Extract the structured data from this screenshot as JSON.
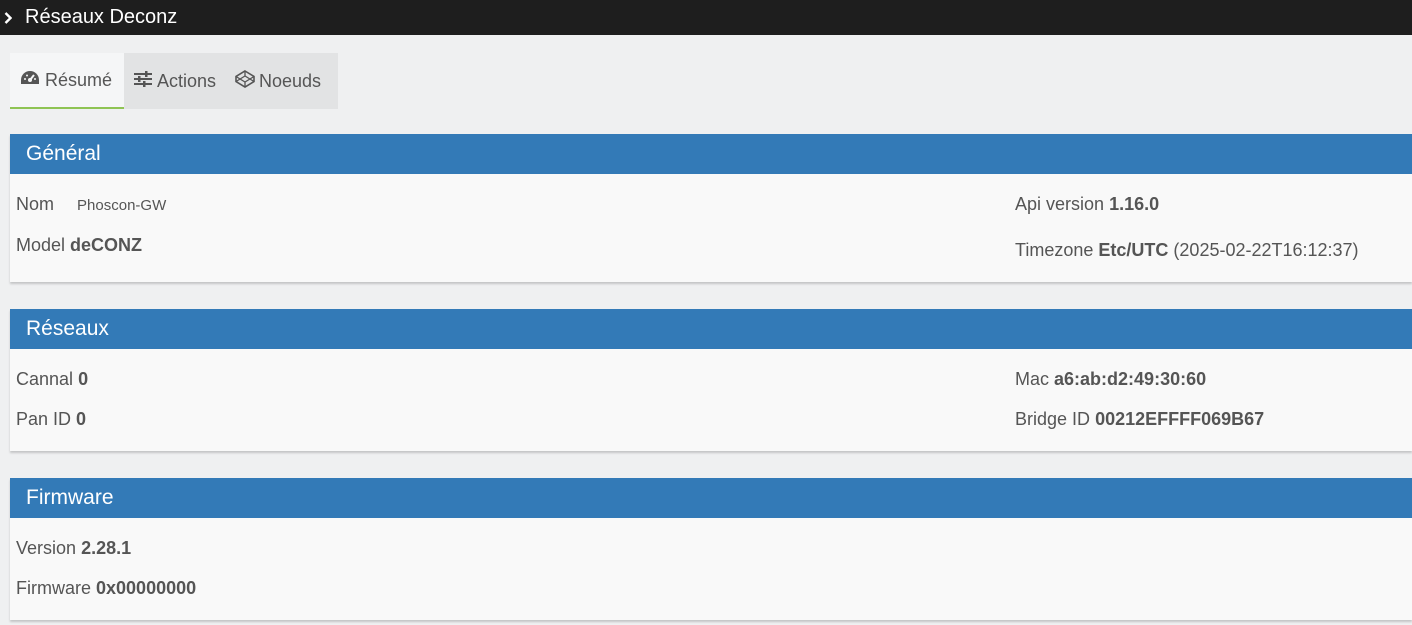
{
  "header": {
    "title": "Réseaux Deconz",
    "icon": "chevron-right-icon"
  },
  "tabs": [
    {
      "label": "Résumé",
      "icon": "dashboard-gauge-icon",
      "active": true
    },
    {
      "label": "Actions",
      "icon": "sliders-icon",
      "active": false
    },
    {
      "label": "Noeuds",
      "icon": "codepen-cube-icon",
      "active": false
    }
  ],
  "general": {
    "title": "Général",
    "name_label": "Nom",
    "name_value": "Phoscon-GW",
    "model_label": "Model",
    "model_value": "deCONZ",
    "api_label": "Api version",
    "api_value": "1.16.0",
    "tz_label": "Timezone",
    "tz_value": "Etc/UTC",
    "tz_time": "(2025-02-22T16:12:37)"
  },
  "network": {
    "title": "Réseaux",
    "channel_label": "Cannal",
    "channel_value": "0",
    "panid_label": "Pan ID",
    "panid_value": "0",
    "mac_label": "Mac",
    "mac_value": "a6:ab:d2:49:30:60",
    "bridge_label": "Bridge ID",
    "bridge_value": "00212EFFFF069B67"
  },
  "firmware": {
    "title": "Firmware",
    "version_label": "Version",
    "version_value": "2.28.1",
    "fw_label": "Firmware",
    "fw_value": "0x00000000"
  },
  "colors": {
    "header_bg": "#1e1e1e",
    "panel_head": "#337ab7",
    "tab_active_border": "#8fc454"
  }
}
